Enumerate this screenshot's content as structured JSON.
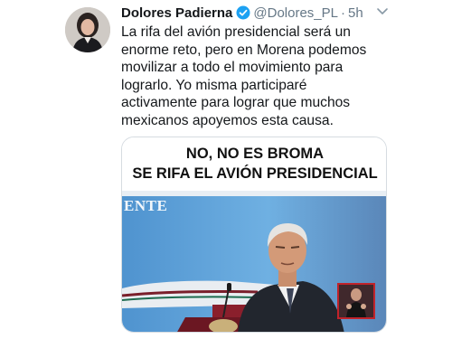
{
  "tweet": {
    "author_name": "Dolores Padierna",
    "handle": "@Dolores_PL",
    "separator": "·",
    "time": "5h",
    "body_lines": [
      "La rifa del avión presidencial será un",
      "enorme reto, pero en Morena podemos",
      "movilizar a todo el movimiento para",
      "lograrlo. Yo misma participaré",
      "activamente para lograr que muchos",
      "mexicanos apoyemos esta causa."
    ]
  },
  "media": {
    "caption_line1": "NO, NO ES BROMA",
    "caption_line2": "SE RIFA EL AVIÓN PRESIDENCIAL",
    "background_text": "ENTE"
  },
  "icons": {
    "verified": "verified-badge-icon",
    "caret": "chevron-down-icon"
  },
  "colors": {
    "verified_blue": "#1da1f2",
    "muted_text": "#657786",
    "sign_border": "#c0232b"
  }
}
